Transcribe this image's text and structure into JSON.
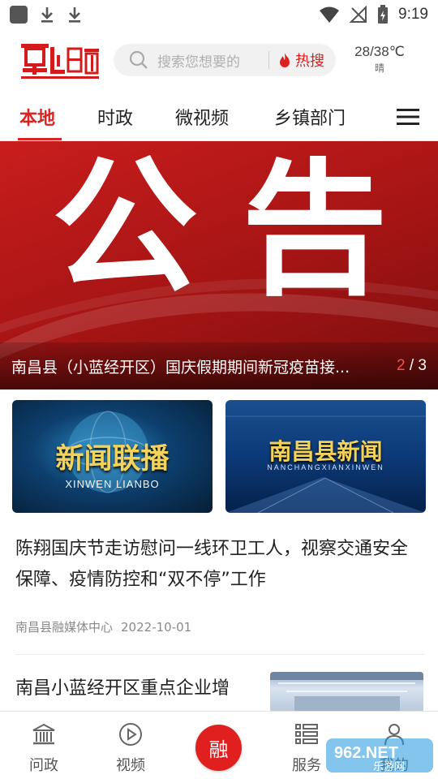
{
  "status_bar": {
    "time": "9:19"
  },
  "header": {
    "logo_text": "掌上昌南",
    "search": {
      "placeholder": "搜索您想要的",
      "hot_label": "热搜"
    },
    "weather": {
      "temp": "28/38℃",
      "condition": "晴"
    }
  },
  "tabs": [
    {
      "label": "本地",
      "active": true
    },
    {
      "label": "时政",
      "active": false
    },
    {
      "label": "微视频",
      "active": false
    },
    {
      "label": "乡镇部门",
      "active": false
    }
  ],
  "banner": {
    "chars": [
      "公",
      "告"
    ],
    "title": "南昌县（小蓝经开区）国庆假期期间新冠疫苗接...",
    "pager_current": "2",
    "pager_sep": " / ",
    "pager_total": "3"
  },
  "video_cards": [
    {
      "title": "新闻联播",
      "subtitle": "XINWEN LIANBO"
    },
    {
      "title": "南昌县新闻",
      "subtitle": "NANCHANGXIANXINWEN"
    }
  ],
  "news": [
    {
      "title": "陈翔国庆节走访慰问一线环卫工人，视察交通安全保障、疫情防控和“双不停”工作",
      "source": "南昌县融媒体中心",
      "date": "2022-10-01"
    },
    {
      "title": "南昌小蓝经开区重点企业增"
    }
  ],
  "bottom_nav": {
    "items": [
      {
        "label": "问政",
        "icon": "building-icon"
      },
      {
        "label": "视频",
        "icon": "play-icon"
      },
      {
        "label": "服务",
        "icon": "list-icon"
      },
      {
        "label": "我的",
        "icon": "user-icon"
      }
    ],
    "center_label": "融"
  },
  "watermark_text": "962.NET 乐游网",
  "colors": {
    "accent": "#e02020",
    "banner_red": "#b71616"
  }
}
